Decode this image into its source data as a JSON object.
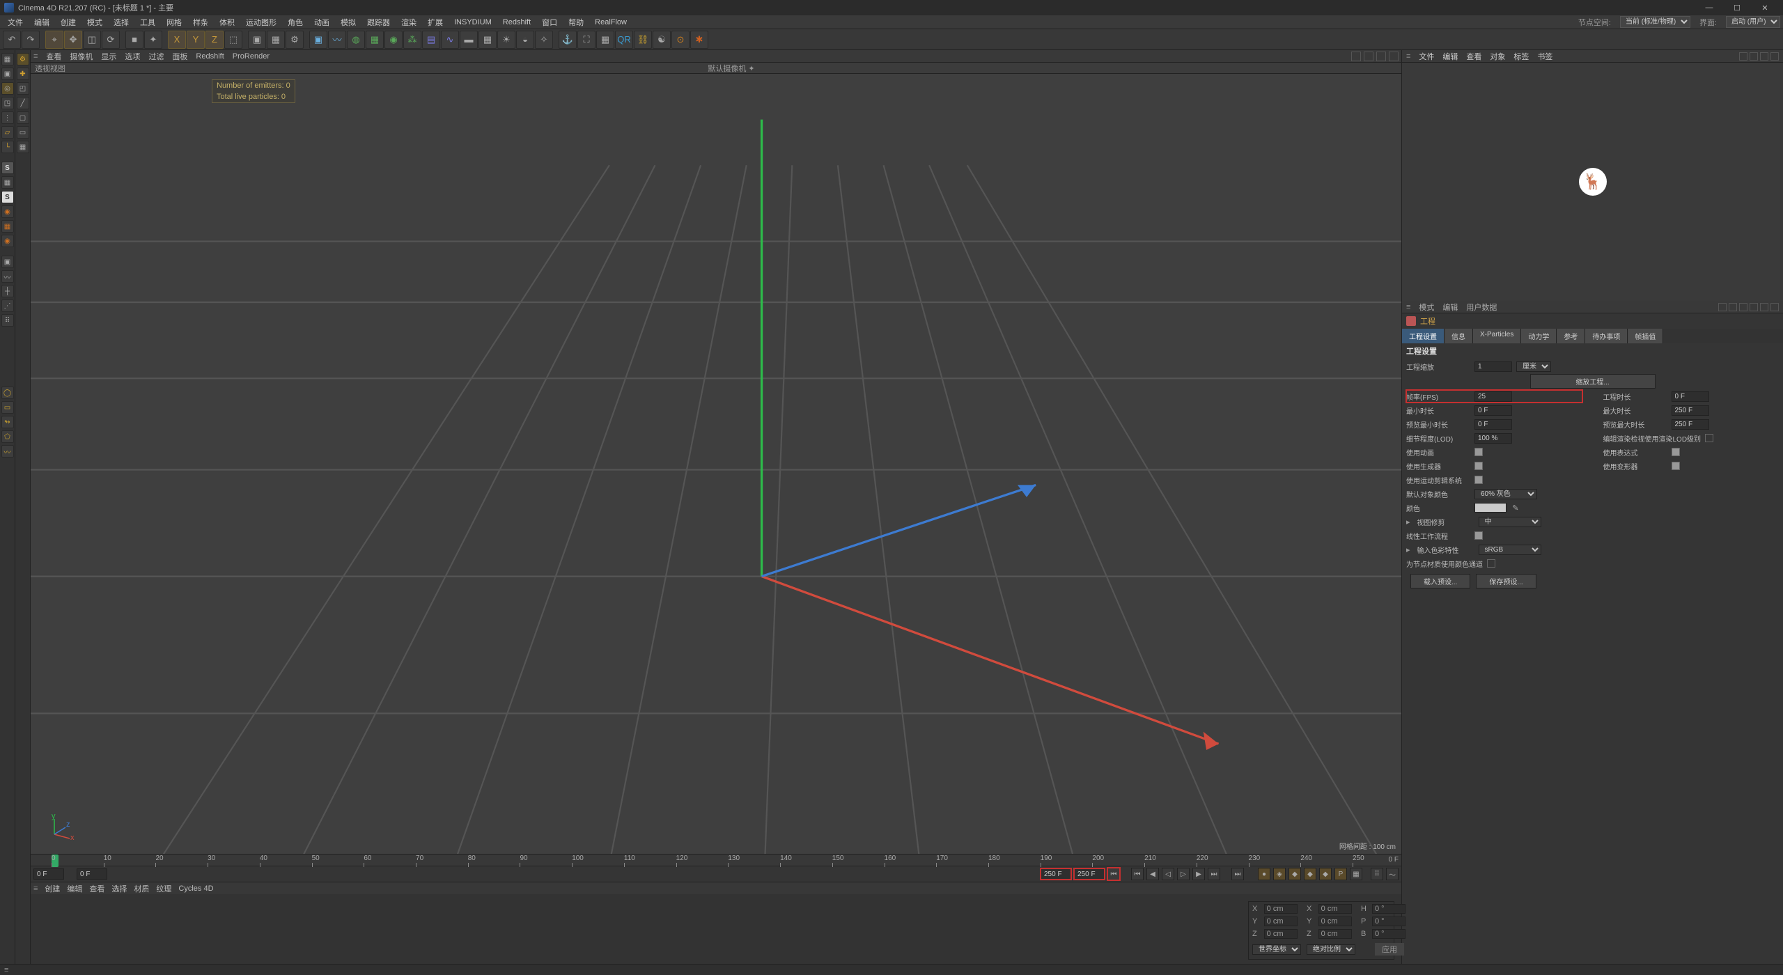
{
  "titlebar": {
    "text": "Cinema 4D R21.207 (RC) - [未标题 1 *] - 主要"
  },
  "winbtns": {
    "min": "—",
    "max": "☐",
    "close": "✕"
  },
  "menu": [
    "文件",
    "编辑",
    "创建",
    "模式",
    "选择",
    "工具",
    "网格",
    "样条",
    "体积",
    "运动图形",
    "角色",
    "动画",
    "模拟",
    "跟踪器",
    "渲染",
    "扩展",
    "INSYDIUM",
    "Redshift",
    "窗口",
    "帮助",
    "RealFlow"
  ],
  "menu_right": {
    "nodespace": "节点空间:",
    "nodespace_val": "当前 (标准/物理)",
    "layout": "界面:",
    "layout_val": "启动 (用户)"
  },
  "vp_menu": [
    "查看",
    "摄像机",
    "显示",
    "选项",
    "过滤",
    "面板",
    "Redshift",
    "ProRender"
  ],
  "vp_title_left": "透视视图",
  "vp_title_center": "默认摄像机",
  "hud": {
    "emitters": "Number of emitters: 0",
    "particles": "Total live particles: 0"
  },
  "vp_footer": "网格间距 : 100 cm",
  "timeline": {
    "start": 0,
    "end": 250,
    "ticks": [
      0,
      10,
      20,
      30,
      40,
      50,
      60,
      70,
      80,
      90,
      100,
      110,
      120,
      130,
      140,
      150,
      160,
      170,
      180,
      190,
      200,
      210,
      220,
      230,
      240,
      250
    ],
    "end_label": "0 F"
  },
  "tl_fields": {
    "cur": "0 F",
    "f1": "0 F",
    "f2": "250 F",
    "f3": "250 F"
  },
  "mat_menu": [
    "创建",
    "编辑",
    "查看",
    "选择",
    "材质",
    "纹理",
    "Cycles 4D"
  ],
  "coord": {
    "X": "0 cm",
    "X2": "0 cm",
    "H": "0 °",
    "Y": "0 cm",
    "Y2": "0 cm",
    "P": "0 °",
    "Z": "0 cm",
    "Z2": "0 cm",
    "B": "0 °",
    "sel1": "世界坐标",
    "sel2": "绝对比例",
    "apply": "应用"
  },
  "obj_menu": [
    "文件",
    "编辑",
    "查看",
    "对象",
    "标签",
    "书签"
  ],
  "attr_menu": [
    "模式",
    "编辑",
    "用户数据"
  ],
  "attr_title": "工程",
  "attr_tabs": [
    "工程设置",
    "信息",
    "X-Particles",
    "动力学",
    "参考",
    "待办事项",
    "帧插值"
  ],
  "attr_sub": "工程设置",
  "attrs": {
    "scale_lbl": "工程缩放",
    "scale_val": "1",
    "scale_unit": "厘米",
    "scalebtn": "缩放工程...",
    "fps_lbl": "帧率(FPS)",
    "fps_val": "25",
    "projtime_lbl": "工程时长",
    "projtime_val": "0 F",
    "mintime_lbl": "最小时长",
    "mintime_val": "0 F",
    "maxtime_lbl": "最大时长",
    "maxtime_val": "250 F",
    "prevmin_lbl": "预览最小时长",
    "prevmin_val": "0 F",
    "prevmax_lbl": "预览最大时长",
    "prevmax_val": "250 F",
    "lod_lbl": "细节程度(LOD)",
    "lod_val": "100 %",
    "lod_chk_lbl": "编辑渲染检视使用渲染LOD级别",
    "anim_lbl": "使用动画",
    "expr_lbl": "使用表达式",
    "gen_lbl": "使用生成器",
    "def_lbl": "使用变形器",
    "motion_lbl": "使用运动剪辑系统",
    "objcolor_lbl": "默认对象颜色",
    "objcolor_val": "60% 灰色",
    "color_lbl": "颜色",
    "clip_lbl": "视图修剪",
    "clip_val": "中",
    "linear_lbl": "线性工作流程",
    "colorprofile_lbl": "输入色彩特性",
    "colorprofile_val": "sRGB",
    "nodecolor_lbl": "为节点材质使用颜色通道",
    "loadpreset": "载入预设...",
    "savepreset": "保存预设..."
  }
}
